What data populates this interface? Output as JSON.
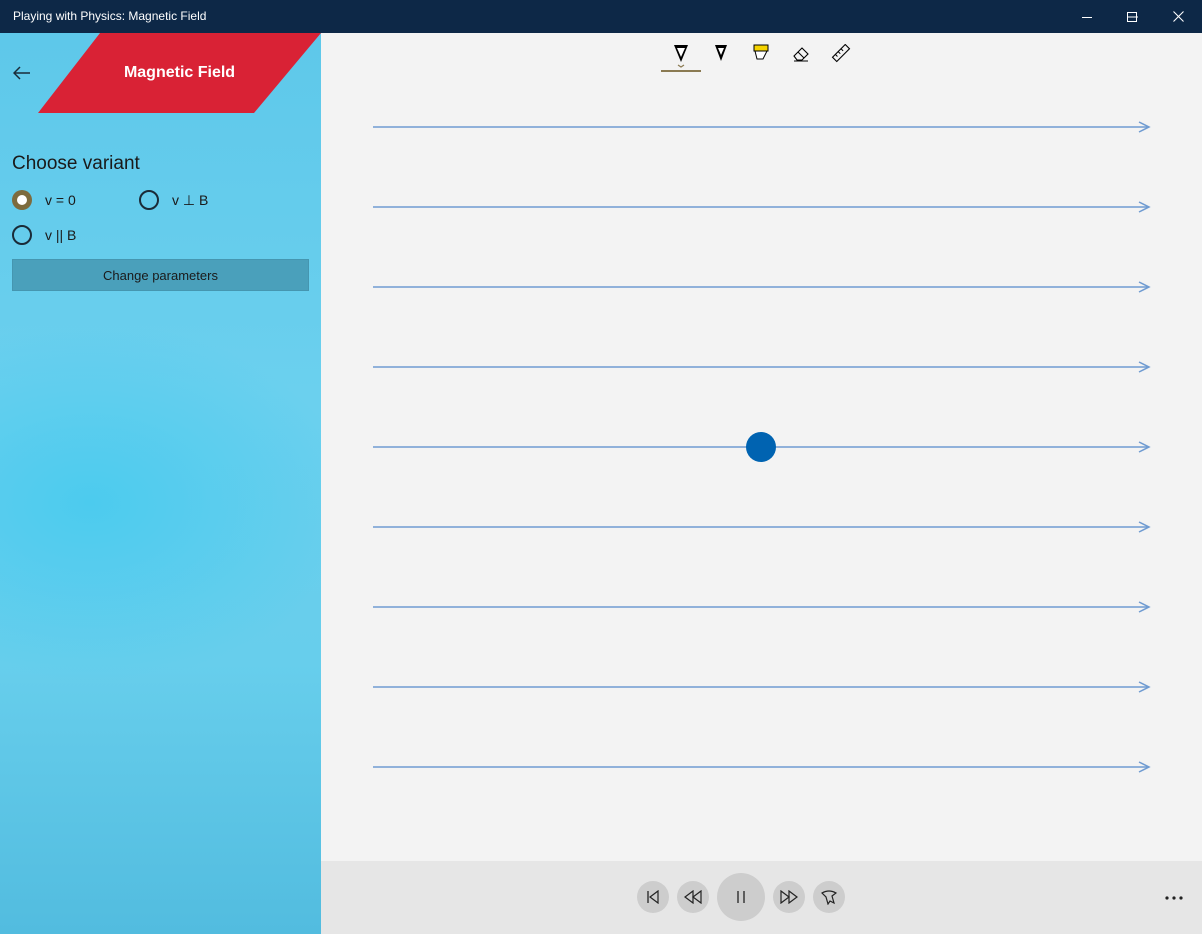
{
  "window": {
    "title": "Playing with Physics: Magnetic Field",
    "controls": [
      "minimize-icon",
      "maximize-icon",
      "close-icon"
    ]
  },
  "sidebar": {
    "back_icon": "back-arrow-icon",
    "header_title": "Magnetic Field",
    "choose_label": "Choose variant",
    "variants": [
      {
        "label": "v = 0",
        "checked": true
      },
      {
        "label": "v ⊥ B",
        "checked": false
      },
      {
        "label": "v || B",
        "checked": false
      }
    ],
    "change_button": "Change parameters"
  },
  "toolbar": {
    "tools": [
      "ballpoint-pen-icon",
      "pencil-icon",
      "highlighter-icon",
      "eraser-icon",
      "ruler-icon"
    ],
    "active_tool": "ballpoint-pen-icon"
  },
  "canvas": {
    "field_line_count": 9,
    "field_direction": "right",
    "particle_color": "#0063b1",
    "field_line_color": "#6f9bd1"
  },
  "playback": {
    "buttons": [
      "skip-back-icon",
      "rewind-icon",
      "pause-icon",
      "fast-forward-icon",
      "touch-mode-icon"
    ],
    "more_icon": "more-icon"
  },
  "colors": {
    "titlebar": "#0d2847",
    "banner": "#d92235",
    "radio_checked": "#7d6b3e"
  }
}
